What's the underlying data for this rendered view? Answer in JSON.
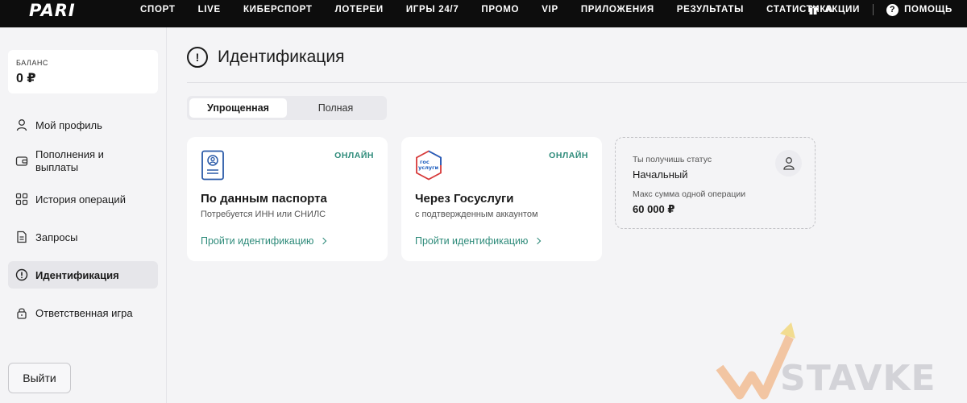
{
  "header": {
    "logo": "PARI",
    "nav": [
      "СПОРТ",
      "LIVE",
      "КИБЕРСПОРТ",
      "ЛОТЕРЕИ",
      "ИГРЫ 24/7",
      "ПРОМО",
      "VIP",
      "ПРИЛОЖЕНИЯ",
      "РЕЗУЛЬТАТЫ",
      "СТАТИСТИКА"
    ],
    "promo_label": "АКЦИИ",
    "help_label": "ПОМОЩЬ"
  },
  "sidebar": {
    "balance_label": "БАЛАНС",
    "balance_value": "0 ₽",
    "items": [
      {
        "label": "Мой профиль",
        "icon": "user-icon"
      },
      {
        "label": "Пополнения и выплаты",
        "icon": "wallet-icon"
      },
      {
        "label": "История операций",
        "icon": "grid-icon"
      },
      {
        "label": "Запросы",
        "icon": "document-icon"
      },
      {
        "label": "Идентификация",
        "icon": "alert-circle-icon"
      },
      {
        "label": "Ответственная игра",
        "icon": "lock-icon"
      }
    ],
    "logout_label": "Выйти"
  },
  "main": {
    "title": "Идентификация",
    "tabs": [
      {
        "label": "Упрощенная",
        "active": true
      },
      {
        "label": "Полная",
        "active": false
      }
    ],
    "cards": [
      {
        "badge": "ОНЛАЙН",
        "title": "По данным паспорта",
        "subtitle": "Потребуется ИНН или СНИЛС",
        "link": "Пройти идентификацию",
        "icon": "passport-icon"
      },
      {
        "badge": "ОНЛАЙН",
        "title": "Через Госуслуги",
        "subtitle": "с подтвержденным аккаунтом",
        "link": "Пройти идентификацию",
        "icon": "gosuslugi-icon",
        "icon_text_top": "гос",
        "icon_text_bottom": "услуги"
      }
    ],
    "status": {
      "label": "Ты получишь статус",
      "value": "Начальный",
      "limit_label": "Макс сумма одной операции",
      "limit_value": "60 000 ₽"
    }
  },
  "watermark": "STAVKE",
  "colors": {
    "accent": "#2e8b7a",
    "topbar": "#0d0d0d",
    "background": "#f4f4f6"
  }
}
